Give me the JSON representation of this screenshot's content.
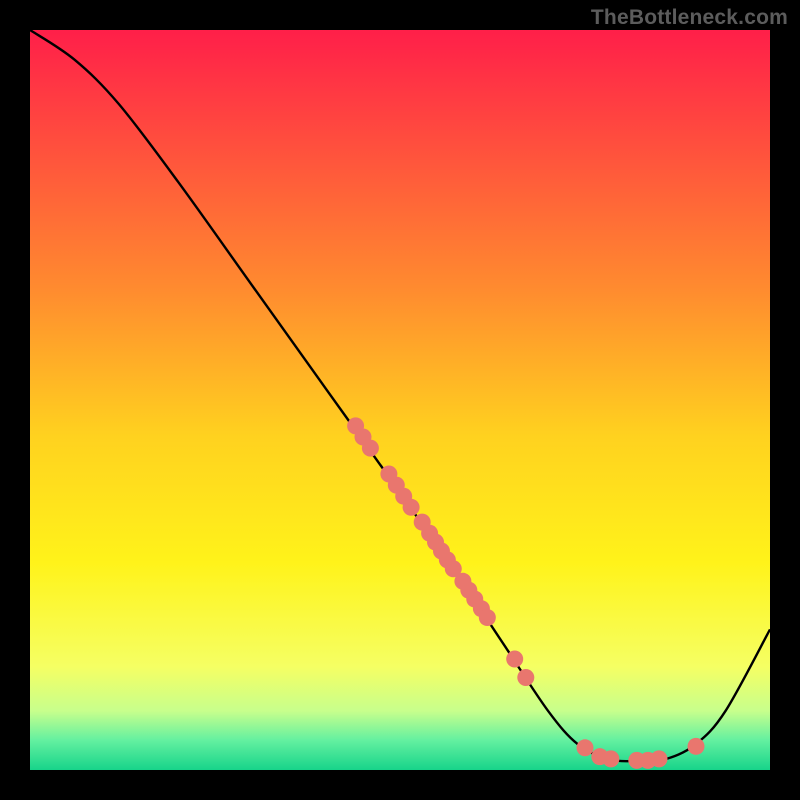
{
  "watermark": "TheBottleneck.com",
  "chart_data": {
    "type": "line",
    "title": "",
    "xlabel": "",
    "ylabel": "",
    "xlim": [
      0,
      100
    ],
    "ylim": [
      0,
      100
    ],
    "gradient_stops": [
      {
        "offset": 0,
        "color": "#ff1f49"
      },
      {
        "offset": 35,
        "color": "#ff8b2f"
      },
      {
        "offset": 55,
        "color": "#ffd21f"
      },
      {
        "offset": 72,
        "color": "#fff31a"
      },
      {
        "offset": 86,
        "color": "#f5ff63"
      },
      {
        "offset": 92,
        "color": "#c8ff8c"
      },
      {
        "offset": 96,
        "color": "#63f0a0"
      },
      {
        "offset": 100,
        "color": "#17d48a"
      }
    ],
    "curve": [
      {
        "x": 0,
        "y": 100
      },
      {
        "x": 6,
        "y": 96
      },
      {
        "x": 12,
        "y": 90
      },
      {
        "x": 20,
        "y": 79.5
      },
      {
        "x": 30,
        "y": 65.5
      },
      {
        "x": 40,
        "y": 51.5
      },
      {
        "x": 50,
        "y": 37.5
      },
      {
        "x": 58,
        "y": 26
      },
      {
        "x": 64,
        "y": 17
      },
      {
        "x": 70,
        "y": 8
      },
      {
        "x": 74,
        "y": 3.5
      },
      {
        "x": 78,
        "y": 1.5
      },
      {
        "x": 82,
        "y": 1.2
      },
      {
        "x": 86,
        "y": 1.5
      },
      {
        "x": 90,
        "y": 3.5
      },
      {
        "x": 94,
        "y": 8
      },
      {
        "x": 100,
        "y": 19
      }
    ],
    "scatter": [
      {
        "x": 44,
        "y": 46.5
      },
      {
        "x": 45,
        "y": 45
      },
      {
        "x": 46,
        "y": 43.5
      },
      {
        "x": 48.5,
        "y": 40
      },
      {
        "x": 49.5,
        "y": 38.5
      },
      {
        "x": 50.5,
        "y": 37
      },
      {
        "x": 51.5,
        "y": 35.5
      },
      {
        "x": 53,
        "y": 33.5
      },
      {
        "x": 54,
        "y": 32
      },
      {
        "x": 54.8,
        "y": 30.8
      },
      {
        "x": 55.6,
        "y": 29.6
      },
      {
        "x": 56.4,
        "y": 28.4
      },
      {
        "x": 57.2,
        "y": 27.2
      },
      {
        "x": 58.5,
        "y": 25.5
      },
      {
        "x": 59.3,
        "y": 24.3
      },
      {
        "x": 60.1,
        "y": 23.1
      },
      {
        "x": 61,
        "y": 21.8
      },
      {
        "x": 61.8,
        "y": 20.6
      },
      {
        "x": 65.5,
        "y": 15
      },
      {
        "x": 67,
        "y": 12.5
      },
      {
        "x": 75,
        "y": 3
      },
      {
        "x": 77,
        "y": 1.8
      },
      {
        "x": 78.5,
        "y": 1.5
      },
      {
        "x": 82,
        "y": 1.3
      },
      {
        "x": 83.5,
        "y": 1.3
      },
      {
        "x": 85,
        "y": 1.5
      },
      {
        "x": 90,
        "y": 3.2
      }
    ],
    "scatter_color": "#e9766e",
    "curve_color": "#000000"
  }
}
